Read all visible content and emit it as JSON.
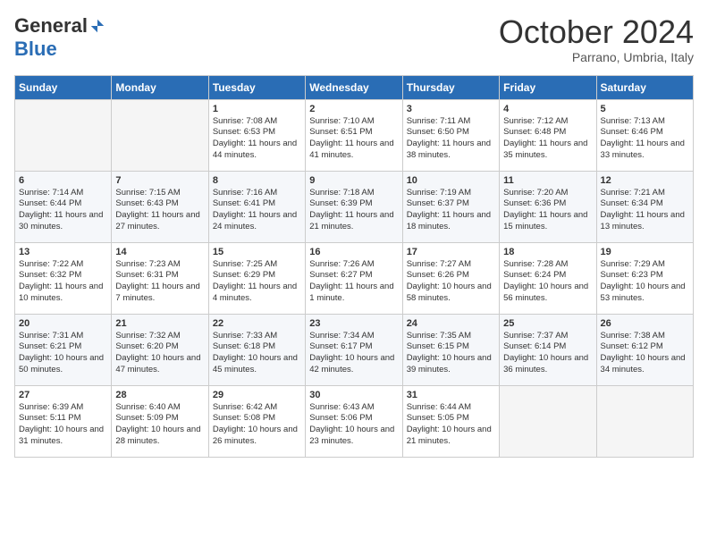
{
  "logo": {
    "general": "General",
    "blue": "Blue"
  },
  "title": "October 2024",
  "location": "Parrano, Umbria, Italy",
  "days_of_week": [
    "Sunday",
    "Monday",
    "Tuesday",
    "Wednesday",
    "Thursday",
    "Friday",
    "Saturday"
  ],
  "weeks": [
    [
      {
        "day": null
      },
      {
        "day": null
      },
      {
        "day": "1",
        "sunrise": "Sunrise: 7:08 AM",
        "sunset": "Sunset: 6:53 PM",
        "daylight": "Daylight: 11 hours and 44 minutes."
      },
      {
        "day": "2",
        "sunrise": "Sunrise: 7:10 AM",
        "sunset": "Sunset: 6:51 PM",
        "daylight": "Daylight: 11 hours and 41 minutes."
      },
      {
        "day": "3",
        "sunrise": "Sunrise: 7:11 AM",
        "sunset": "Sunset: 6:50 PM",
        "daylight": "Daylight: 11 hours and 38 minutes."
      },
      {
        "day": "4",
        "sunrise": "Sunrise: 7:12 AM",
        "sunset": "Sunset: 6:48 PM",
        "daylight": "Daylight: 11 hours and 35 minutes."
      },
      {
        "day": "5",
        "sunrise": "Sunrise: 7:13 AM",
        "sunset": "Sunset: 6:46 PM",
        "daylight": "Daylight: 11 hours and 33 minutes."
      }
    ],
    [
      {
        "day": "6",
        "sunrise": "Sunrise: 7:14 AM",
        "sunset": "Sunset: 6:44 PM",
        "daylight": "Daylight: 11 hours and 30 minutes."
      },
      {
        "day": "7",
        "sunrise": "Sunrise: 7:15 AM",
        "sunset": "Sunset: 6:43 PM",
        "daylight": "Daylight: 11 hours and 27 minutes."
      },
      {
        "day": "8",
        "sunrise": "Sunrise: 7:16 AM",
        "sunset": "Sunset: 6:41 PM",
        "daylight": "Daylight: 11 hours and 24 minutes."
      },
      {
        "day": "9",
        "sunrise": "Sunrise: 7:18 AM",
        "sunset": "Sunset: 6:39 PM",
        "daylight": "Daylight: 11 hours and 21 minutes."
      },
      {
        "day": "10",
        "sunrise": "Sunrise: 7:19 AM",
        "sunset": "Sunset: 6:37 PM",
        "daylight": "Daylight: 11 hours and 18 minutes."
      },
      {
        "day": "11",
        "sunrise": "Sunrise: 7:20 AM",
        "sunset": "Sunset: 6:36 PM",
        "daylight": "Daylight: 11 hours and 15 minutes."
      },
      {
        "day": "12",
        "sunrise": "Sunrise: 7:21 AM",
        "sunset": "Sunset: 6:34 PM",
        "daylight": "Daylight: 11 hours and 13 minutes."
      }
    ],
    [
      {
        "day": "13",
        "sunrise": "Sunrise: 7:22 AM",
        "sunset": "Sunset: 6:32 PM",
        "daylight": "Daylight: 11 hours and 10 minutes."
      },
      {
        "day": "14",
        "sunrise": "Sunrise: 7:23 AM",
        "sunset": "Sunset: 6:31 PM",
        "daylight": "Daylight: 11 hours and 7 minutes."
      },
      {
        "day": "15",
        "sunrise": "Sunrise: 7:25 AM",
        "sunset": "Sunset: 6:29 PM",
        "daylight": "Daylight: 11 hours and 4 minutes."
      },
      {
        "day": "16",
        "sunrise": "Sunrise: 7:26 AM",
        "sunset": "Sunset: 6:27 PM",
        "daylight": "Daylight: 11 hours and 1 minute."
      },
      {
        "day": "17",
        "sunrise": "Sunrise: 7:27 AM",
        "sunset": "Sunset: 6:26 PM",
        "daylight": "Daylight: 10 hours and 58 minutes."
      },
      {
        "day": "18",
        "sunrise": "Sunrise: 7:28 AM",
        "sunset": "Sunset: 6:24 PM",
        "daylight": "Daylight: 10 hours and 56 minutes."
      },
      {
        "day": "19",
        "sunrise": "Sunrise: 7:29 AM",
        "sunset": "Sunset: 6:23 PM",
        "daylight": "Daylight: 10 hours and 53 minutes."
      }
    ],
    [
      {
        "day": "20",
        "sunrise": "Sunrise: 7:31 AM",
        "sunset": "Sunset: 6:21 PM",
        "daylight": "Daylight: 10 hours and 50 minutes."
      },
      {
        "day": "21",
        "sunrise": "Sunrise: 7:32 AM",
        "sunset": "Sunset: 6:20 PM",
        "daylight": "Daylight: 10 hours and 47 minutes."
      },
      {
        "day": "22",
        "sunrise": "Sunrise: 7:33 AM",
        "sunset": "Sunset: 6:18 PM",
        "daylight": "Daylight: 10 hours and 45 minutes."
      },
      {
        "day": "23",
        "sunrise": "Sunrise: 7:34 AM",
        "sunset": "Sunset: 6:17 PM",
        "daylight": "Daylight: 10 hours and 42 minutes."
      },
      {
        "day": "24",
        "sunrise": "Sunrise: 7:35 AM",
        "sunset": "Sunset: 6:15 PM",
        "daylight": "Daylight: 10 hours and 39 minutes."
      },
      {
        "day": "25",
        "sunrise": "Sunrise: 7:37 AM",
        "sunset": "Sunset: 6:14 PM",
        "daylight": "Daylight: 10 hours and 36 minutes."
      },
      {
        "day": "26",
        "sunrise": "Sunrise: 7:38 AM",
        "sunset": "Sunset: 6:12 PM",
        "daylight": "Daylight: 10 hours and 34 minutes."
      }
    ],
    [
      {
        "day": "27",
        "sunrise": "Sunrise: 6:39 AM",
        "sunset": "Sunset: 5:11 PM",
        "daylight": "Daylight: 10 hours and 31 minutes."
      },
      {
        "day": "28",
        "sunrise": "Sunrise: 6:40 AM",
        "sunset": "Sunset: 5:09 PM",
        "daylight": "Daylight: 10 hours and 28 minutes."
      },
      {
        "day": "29",
        "sunrise": "Sunrise: 6:42 AM",
        "sunset": "Sunset: 5:08 PM",
        "daylight": "Daylight: 10 hours and 26 minutes."
      },
      {
        "day": "30",
        "sunrise": "Sunrise: 6:43 AM",
        "sunset": "Sunset: 5:06 PM",
        "daylight": "Daylight: 10 hours and 23 minutes."
      },
      {
        "day": "31",
        "sunrise": "Sunrise: 6:44 AM",
        "sunset": "Sunset: 5:05 PM",
        "daylight": "Daylight: 10 hours and 21 minutes."
      },
      {
        "day": null
      },
      {
        "day": null
      }
    ]
  ]
}
